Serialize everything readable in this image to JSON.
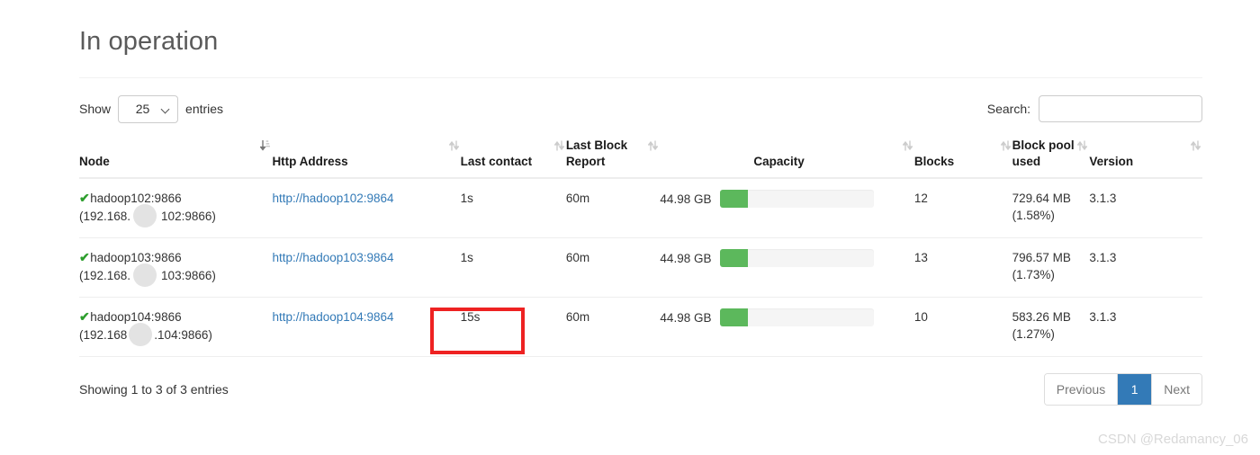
{
  "page": {
    "title": "In operation"
  },
  "controls": {
    "show_label": "Show",
    "entries_label": "entries",
    "page_length_value": "25",
    "page_length_options": [
      "25"
    ],
    "search_label": "Search:",
    "search_value": "",
    "search_placeholder": ""
  },
  "table": {
    "columns": [
      {
        "label": "Node",
        "sort": "desc-active"
      },
      {
        "label": "Http Address",
        "sort": "none"
      },
      {
        "label": "Last contact",
        "sort": "none"
      },
      {
        "label": "Last Block Report",
        "sort": "none"
      },
      {
        "label": "Capacity",
        "sort": "none"
      },
      {
        "label": "Blocks",
        "sort": "none"
      },
      {
        "label": "Block pool used",
        "sort": "none"
      },
      {
        "label": "Version",
        "sort": "none"
      }
    ],
    "rows": [
      {
        "status_icon": "check-icon",
        "node_name": "hadoop102:9866",
        "node_ip_prefix": "(192.168.",
        "node_ip_suffix": "102:9866)",
        "http_address": "http://hadoop102:9864",
        "last_contact": "1s",
        "last_block_report": "60m",
        "capacity": "44.98 GB",
        "capacity_pct": 18,
        "blocks": "12",
        "block_pool_used": "729.64 MB",
        "block_pool_pct": "(1.58%)",
        "version": "3.1.3"
      },
      {
        "status_icon": "check-icon",
        "node_name": "hadoop103:9866",
        "node_ip_prefix": "(192.168.",
        "node_ip_suffix": "103:9866)",
        "http_address": "http://hadoop103:9864",
        "last_contact": "1s",
        "last_block_report": "60m",
        "capacity": "44.98 GB",
        "capacity_pct": 18,
        "blocks": "13",
        "block_pool_used": "796.57 MB",
        "block_pool_pct": "(1.73%)",
        "version": "3.1.3"
      },
      {
        "status_icon": "check-icon",
        "node_name": "hadoop104:9866",
        "node_ip_prefix": "(192.168",
        "node_ip_suffix": ".104:9866)",
        "http_address": "http://hadoop104:9864",
        "last_contact": "15s",
        "last_block_report": "60m",
        "capacity": "44.98 GB",
        "capacity_pct": 18,
        "blocks": "10",
        "block_pool_used": "583.26 MB",
        "block_pool_pct": "(1.27%)",
        "version": "3.1.3"
      }
    ]
  },
  "footer": {
    "info": "Showing 1 to 3 of 3 entries",
    "previous_label": "Previous",
    "page_1_label": "1",
    "next_label": "Next"
  },
  "watermark": {
    "text": "CSDN @Redamancy_06"
  },
  "colors": {
    "accent_blue": "#337ab7",
    "progress_green": "#5cb85c",
    "check_green": "#2d9e2d",
    "annotation_red": "#ee2222",
    "link_blue": "#337ab7"
  }
}
